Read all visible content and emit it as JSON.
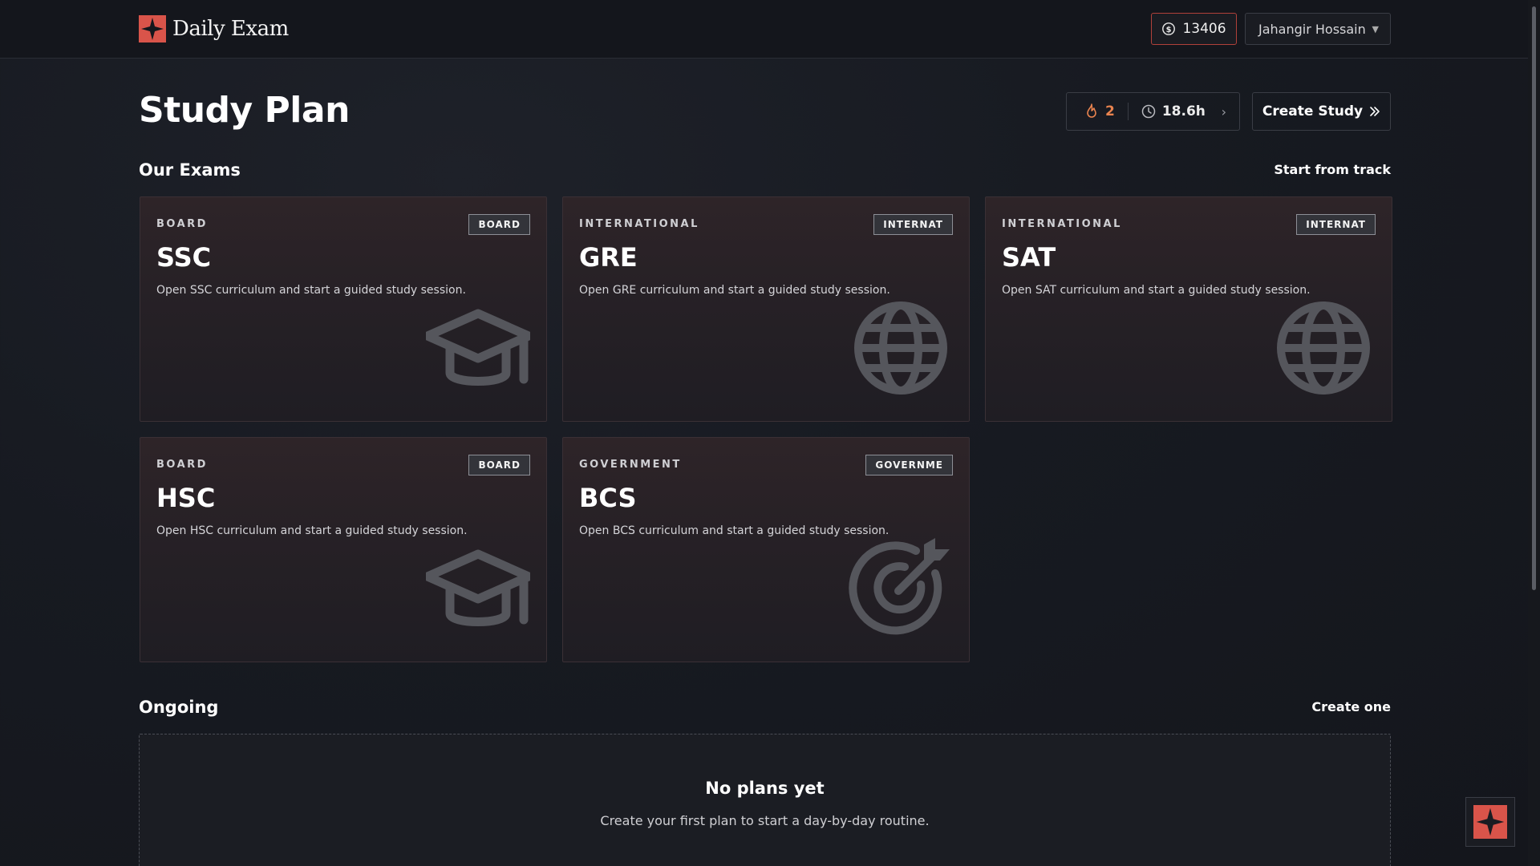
{
  "brand": {
    "name": "Daily Exam"
  },
  "topbar": {
    "coins": "13406",
    "user_name": "Jahangir Hossain",
    "coin_border_color": "#b0413a"
  },
  "header": {
    "title": "Study Plan",
    "streak": "2",
    "hours": "18.6h",
    "create_label": "Create Study",
    "streak_color": "#e9834f"
  },
  "exams": {
    "title": "Our Exams",
    "link": "Start from track",
    "cards": [
      {
        "category": "BOARD",
        "badge": "BOARD",
        "name": "SSC",
        "desc": "Open SSC curriculum and start a guided study session.",
        "icon": "graduation-cap-icon"
      },
      {
        "category": "INTERNATIONAL",
        "badge": "INTERNAT",
        "name": "GRE",
        "desc": "Open GRE curriculum and start a guided study session.",
        "icon": "globe-icon"
      },
      {
        "category": "INTERNATIONAL",
        "badge": "INTERNAT",
        "name": "SAT",
        "desc": "Open SAT curriculum and start a guided study session.",
        "icon": "globe-icon"
      },
      {
        "category": "BOARD",
        "badge": "BOARD",
        "name": "HSC",
        "desc": "Open HSC curriculum and start a guided study session.",
        "icon": "graduation-cap-icon"
      },
      {
        "category": "GOVERNMENT",
        "badge": "GOVERNME",
        "name": "BCS",
        "desc": "Open BCS curriculum and start a guided study session.",
        "icon": "target-icon"
      }
    ]
  },
  "ongoing": {
    "title": "Ongoing",
    "link": "Create one",
    "empty_title": "No plans yet",
    "empty_desc": "Create your first plan to start a day-by-day routine."
  },
  "colors": {
    "accent": "#d9544a",
    "background": "#171a21"
  }
}
